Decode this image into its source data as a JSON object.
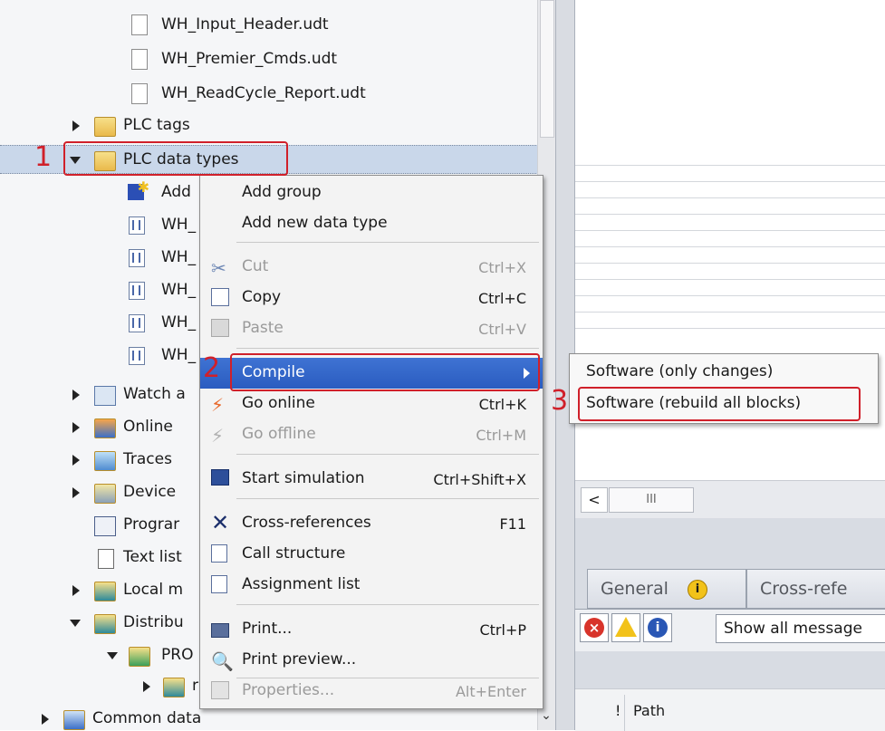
{
  "tree": {
    "items": [
      {
        "label": "WH_Input_Header.udt",
        "icon": "document-icon",
        "type": "doc"
      },
      {
        "label": "WH_Premier_Cmds.udt",
        "icon": "document-icon",
        "type": "doc"
      },
      {
        "label": "WH_ReadCycle_Report.udt",
        "icon": "document-icon",
        "type": "doc"
      },
      {
        "label": "PLC tags",
        "icon": "plc-tags-folder-icon",
        "type": "folder"
      },
      {
        "label": "PLC data types",
        "icon": "data-types-folder-icon",
        "type": "folder"
      },
      {
        "label": "Add",
        "icon": "add-new-icon"
      },
      {
        "label": "WH_",
        "icon": "data-type-icon"
      },
      {
        "label": "WH_",
        "icon": "data-type-icon"
      },
      {
        "label": "WH_",
        "icon": "data-type-icon"
      },
      {
        "label": "WH_",
        "icon": "data-type-icon"
      },
      {
        "label": "WH_",
        "icon": "data-type-icon"
      },
      {
        "label": "Watch a",
        "icon": "watch-table-folder-icon"
      },
      {
        "label": "Online",
        "icon": "online-backup-folder-icon"
      },
      {
        "label": "Traces",
        "icon": "traces-folder-icon"
      },
      {
        "label": "Device",
        "icon": "device-proxy-folder-icon"
      },
      {
        "label": "Prograr",
        "icon": "program-info-icon"
      },
      {
        "label": "Text list",
        "icon": "text-list-icon"
      },
      {
        "label": "Local m",
        "icon": "local-modules-folder-icon"
      },
      {
        "label": "Distribu",
        "icon": "distributed-io-folder-icon"
      },
      {
        "label": "PRO",
        "icon": "profinet-folder-icon"
      },
      {
        "label": "r",
        "icon": "module-folder-icon"
      },
      {
        "label": "Common data",
        "icon": "common-data-folder-icon"
      }
    ]
  },
  "context_menu": {
    "items": [
      {
        "label": "Add group",
        "shortcut": "",
        "disabled": false,
        "icon": ""
      },
      {
        "label": "Add new data type",
        "shortcut": "",
        "disabled": false,
        "icon": ""
      },
      {
        "label": "Cut",
        "shortcut": "Ctrl+X",
        "disabled": true,
        "icon": "scissors-icon"
      },
      {
        "label": "Copy",
        "shortcut": "Ctrl+C",
        "disabled": false,
        "icon": "copy-icon"
      },
      {
        "label": "Paste",
        "shortcut": "Ctrl+V",
        "disabled": true,
        "icon": "paste-icon"
      },
      {
        "label": "Compile",
        "shortcut": "",
        "disabled": false,
        "icon": "",
        "submenu": true
      },
      {
        "label": "Go online",
        "shortcut": "Ctrl+K",
        "disabled": false,
        "icon": "go-online-icon"
      },
      {
        "label": "Go offline",
        "shortcut": "Ctrl+M",
        "disabled": true,
        "icon": "go-offline-icon"
      },
      {
        "label": "Start simulation",
        "shortcut": "Ctrl+Shift+X",
        "disabled": false,
        "icon": "simulation-icon"
      },
      {
        "label": "Cross-references",
        "shortcut": "F11",
        "disabled": false,
        "icon": "cross-references-icon"
      },
      {
        "label": "Call structure",
        "shortcut": "",
        "disabled": false,
        "icon": "call-structure-icon"
      },
      {
        "label": "Assignment list",
        "shortcut": "",
        "disabled": false,
        "icon": "assignment-list-icon"
      },
      {
        "label": "Print...",
        "shortcut": "Ctrl+P",
        "disabled": false,
        "icon": "print-icon"
      },
      {
        "label": "Print preview...",
        "shortcut": "",
        "disabled": false,
        "icon": "print-preview-icon"
      },
      {
        "label": "Properties...",
        "shortcut": "Alt+Enter",
        "disabled": true,
        "icon": "properties-icon"
      }
    ]
  },
  "submenu": {
    "items": [
      "Software (only changes)",
      "Software (rebuild all blocks)"
    ]
  },
  "annotations": [
    "1",
    "2",
    "3"
  ],
  "inspector": {
    "tabs": [
      "General",
      "Cross-refe"
    ],
    "filter_value": "Show all message",
    "grid_columns": [
      "!",
      "Path"
    ],
    "hscroll_left": "<",
    "hscroll_thumb": "III"
  },
  "colors": {
    "highlight": "#2a5cc0",
    "annotation_red": "#d0202a",
    "selection": "#c9d7ea"
  }
}
